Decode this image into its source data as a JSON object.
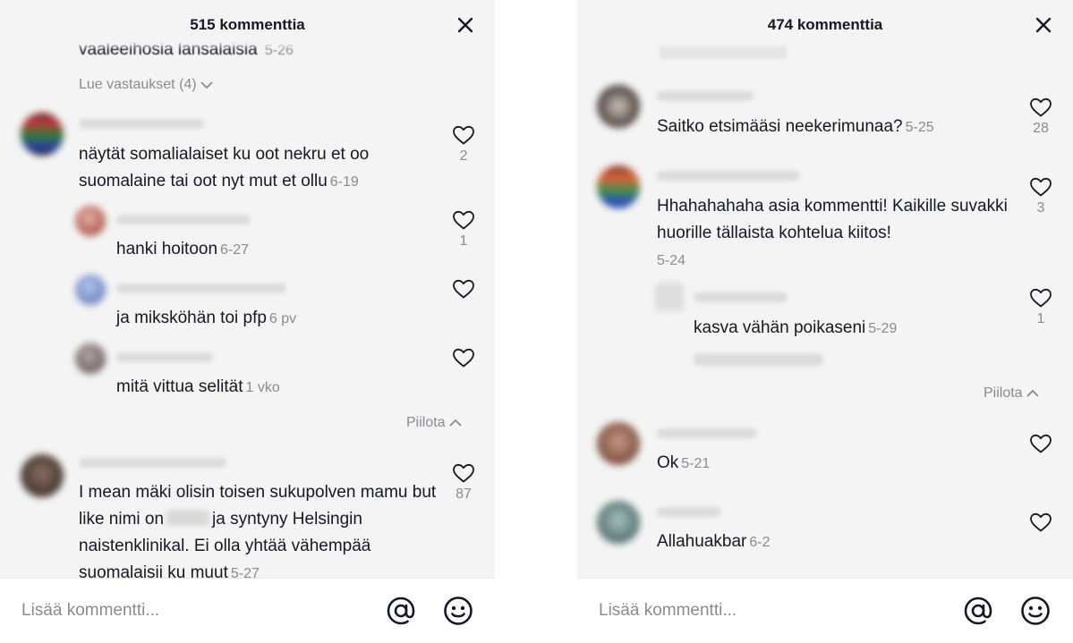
{
  "left": {
    "title": "515 kommenttia",
    "cut_text": "vaaleeihosia lansalaisia",
    "cut_date": "5-26",
    "view_replies": "Lue vastaukset (4)",
    "comments": [
      {
        "text": "näytät somalialaiset ku oot nekru et oo suomalaine tai oot nyt mut et ollu",
        "date": "6-19",
        "likes": "2"
      },
      {
        "text": "hanki hoitoon",
        "date": "6-27",
        "likes": "1"
      },
      {
        "text": "ja miksköhän toi pfp",
        "date": "6 pv",
        "likes": ""
      },
      {
        "text": "mitä vittua selität",
        "date": "1 vko",
        "likes": ""
      },
      {
        "text_before": "I mean mäki olisin toisen sukupolven mamu but like nimi on",
        "text_after": "ja syntyny Helsingin naistenklinikal. Ei olla yhtää vähempää suomalaisii ku muut",
        "date": "5-27",
        "likes": "87"
      }
    ],
    "hide": "Piilota",
    "input_placeholder": "Lisää kommentti..."
  },
  "right": {
    "title": "474 kommenttia",
    "comments": [
      {
        "text": "Saitko etsimääsi neekerimunaa?",
        "date": "5-25",
        "likes": "28"
      },
      {
        "text": "Hhahahahaha asia kommentti! Kaikille suvakki huorille tällaista kohtelua kiitos!",
        "date": "5-24",
        "likes": "3"
      },
      {
        "text": "kasva vähän poikaseni",
        "date": "5-29",
        "likes": "1"
      },
      {
        "text": "Ok",
        "date": "5-21",
        "likes": ""
      },
      {
        "text": "Allahuakbar",
        "date": "6-2",
        "likes": ""
      }
    ],
    "hide": "Piilota",
    "input_placeholder": "Lisää kommentti..."
  },
  "icons": {
    "close": "close-icon",
    "like": "heart-outline-icon",
    "mention": "at-sign-icon",
    "emoji": "smiley-icon",
    "chevron_down": "chevron-down-icon",
    "chevron_up": "chevron-up-icon"
  },
  "colors": {
    "panel_bg": "#f4f4f4",
    "text": "#161823",
    "muted": "#8a8b91"
  }
}
